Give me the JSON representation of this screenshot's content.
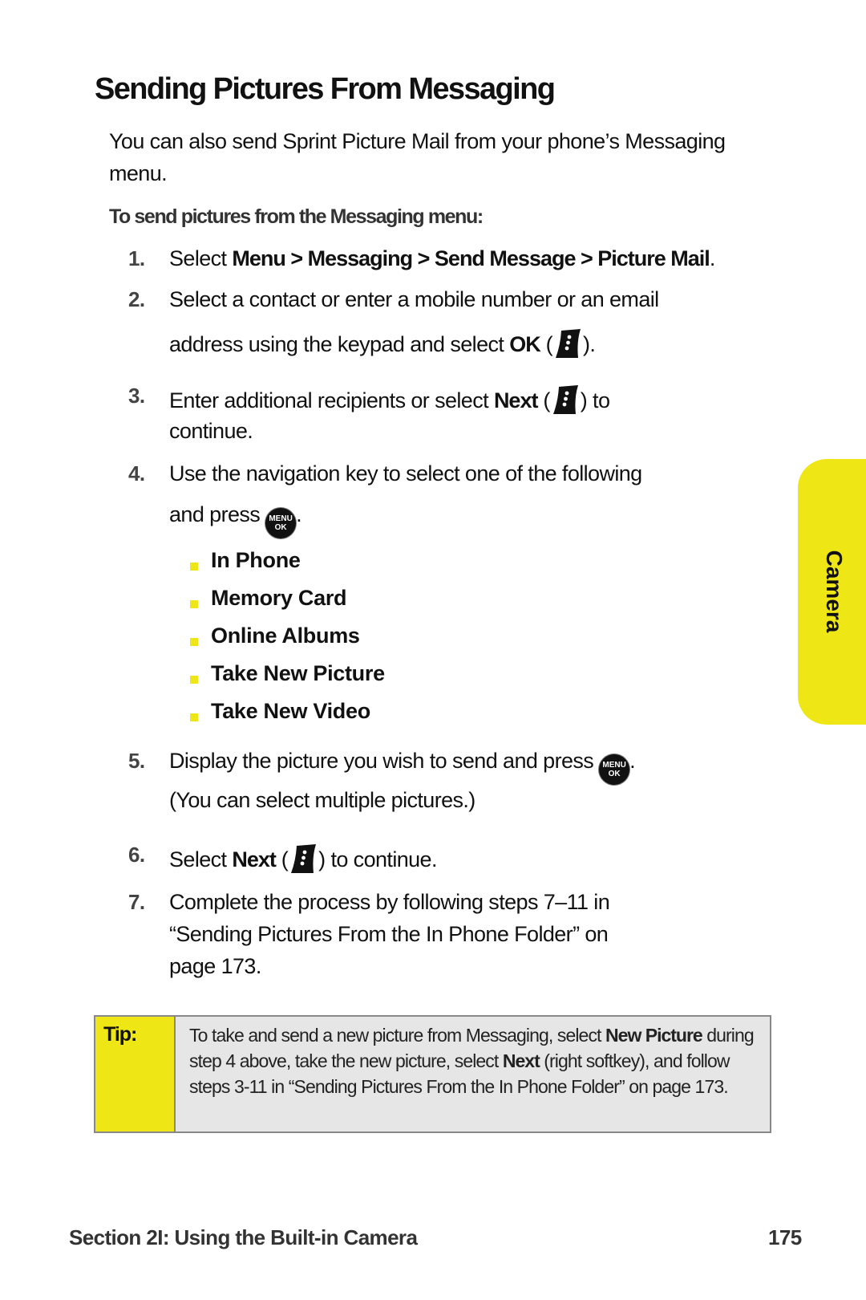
{
  "heading": "Sending Pictures From Messaging",
  "intro": "You can also send Sprint Picture Mail from your phone’s Messaging menu.",
  "subheading": "To send pictures from the Messaging menu:",
  "steps": [
    {
      "num": "1.",
      "pre": "Select ",
      "bold": "Menu > Messaging > Send Message > Picture Mail",
      "post": "."
    },
    {
      "num": "2.",
      "line1": "Select a contact or enter a mobile number or an email",
      "line2_pre": "address using the keypad and select ",
      "line2_bold": "OK",
      "line2_post": ").",
      "open_paren": " ("
    },
    {
      "num": "3.",
      "pre": "Enter additional recipients or select ",
      "bold": "Next",
      "open_paren": " (",
      "post": ") to",
      "line2": "continue."
    },
    {
      "num": "4.",
      "line1": "Use the navigation key to select one of the following",
      "line2_pre": "and press ",
      "line2_post": "."
    },
    {
      "num": "5.",
      "pre": "Display the picture you wish to send and press ",
      "post": ".",
      "line2": "(You can select multiple pictures.)"
    },
    {
      "num": "6.",
      "pre": "Select ",
      "bold": "Next",
      "open_paren": " (",
      "post": ") to continue."
    },
    {
      "num": "7.",
      "line1": "Complete the process by following steps 7–11 in",
      "line2": "“Sending Pictures From the In Phone Folder” on",
      "line3": "page 173."
    }
  ],
  "options": [
    "In Phone",
    "Memory Card",
    "Online Albums",
    "Take New Picture",
    "Take New Video"
  ],
  "icons": {
    "softkey": "right-softkey-icon",
    "menu_ok": {
      "line1": "MENU",
      "line2": "OK"
    }
  },
  "side_tab": {
    "label": "Camera",
    "color": "#eee715"
  },
  "tip": {
    "label": "Tip:",
    "parts": [
      {
        "text": "To take and send a new picture from Messaging, select ",
        "bold": false
      },
      {
        "text": "New Picture",
        "bold": true
      },
      {
        "text": " during step 4 above, take the new picture, select ",
        "bold": false
      },
      {
        "text": "Next",
        "bold": true
      },
      {
        "text": " (right softkey), and follow steps 3-11 in “Sending Pictures From the In Phone Folder” on page 173.",
        "bold": false
      }
    ]
  },
  "footer": {
    "section": "Section 2I: Using the Built-in Camera",
    "page": "175"
  }
}
